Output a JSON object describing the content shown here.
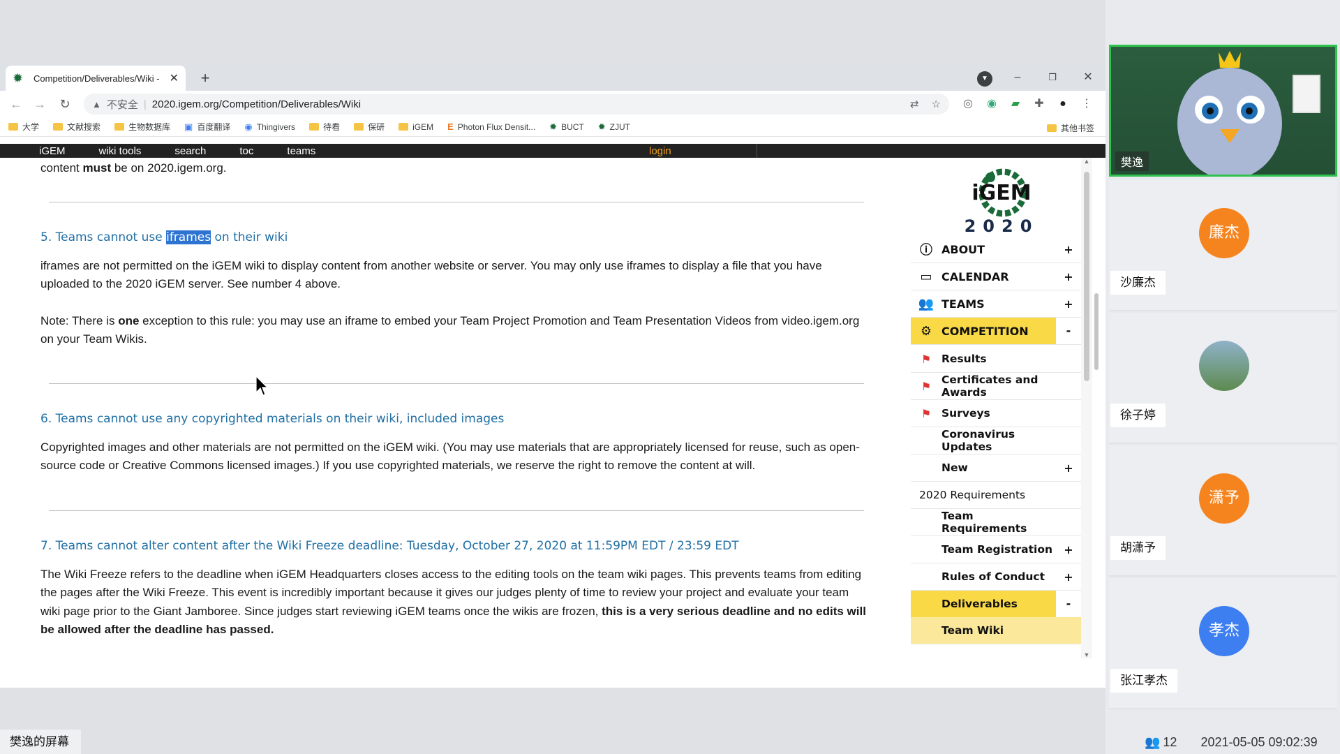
{
  "browser": {
    "tab_title": "Competition/Deliverables/Wiki -",
    "security_label": "不安全",
    "url": "2020.igem.org/Competition/Deliverables/Wiki",
    "bookmarks": [
      "大学",
      "文献搜索",
      "生物数据库",
      "百度翻译",
      "Thingivers",
      "待看",
      "保研",
      "iGEM",
      "Photon Flux Densit...",
      "BUCT",
      "ZJUT"
    ],
    "other_bookmarks": "其他书签"
  },
  "igem_nav": {
    "items": [
      "iGEM",
      "wiki tools",
      "search",
      "toc",
      "teams"
    ],
    "login": "login"
  },
  "article": {
    "top_partial_line": "content must be on 2020.igem.org.",
    "top_must": "must",
    "top_prefix": "content ",
    "top_suffix": " be on 2020.igem.org.",
    "h5_pre": "5. Teams cannot use ",
    "h5_highlight": "iframes",
    "h5_post": " on their wiki",
    "p5a": "iframes are not permitted on the iGEM wiki to display content from another website or server. You may only use iframes to display a file that you have uploaded to the 2020 iGEM server. See number 4 above.",
    "p5b_pre": "Note: There is ",
    "p5b_bold": "one",
    "p5b_post": " exception to this rule: you may use an iframe to embed your Team Project Promotion and Team Presentation Videos from video.igem.org on your Team Wikis.",
    "h6": "6. Teams cannot use any copyrighted materials on their wiki, included images",
    "p6": "Copyrighted images and other materials are not permitted on the iGEM wiki. (You may use materials that are appropriately licensed for reuse, such as open-source code or Creative Commons licensed images.) If you use copyrighted materials, we reserve the right to remove the content at will.",
    "h7": "7. Teams cannot alter content after the Wiki Freeze deadline: Tuesday, October 27, 2020 at 11:59PM EDT / 23:59 EDT",
    "p7_pre": "The Wiki Freeze refers to the deadline when iGEM Headquarters closes access to the editing tools on the team wiki pages. This prevents teams from editing the pages after the Wiki Freeze. This event is incredibly important because it gives our judges plenty of time to review your project and evaluate your team wiki page prior to the Giant Jamboree. Since judges start reviewing iGEM teams once the wikis are frozen, ",
    "p7_bold": "this is a very serious deadline and no edits will be allowed after the deadline has passed."
  },
  "sidebar": {
    "logo_text": "iGEM",
    "logo_year": "2020",
    "menu": [
      {
        "label": "ABOUT",
        "toggle": "+"
      },
      {
        "label": "CALENDAR",
        "toggle": "+"
      },
      {
        "label": "TEAMS",
        "toggle": "+"
      },
      {
        "label": "COMPETITION",
        "toggle": "-"
      },
      {
        "label": "Results",
        "toggle": ""
      },
      {
        "label": "Certificates and Awards",
        "toggle": ""
      },
      {
        "label": "Surveys",
        "toggle": ""
      },
      {
        "label": "Coronavirus Updates",
        "toggle": ""
      },
      {
        "label": "New",
        "toggle": "+"
      },
      {
        "label": "2020 Requirements",
        "toggle": ""
      },
      {
        "label": "Team Requirements",
        "toggle": ""
      },
      {
        "label": "Team Registration",
        "toggle": "+"
      },
      {
        "label": "Rules of Conduct",
        "toggle": "+"
      },
      {
        "label": "Deliverables",
        "toggle": "-"
      },
      {
        "label": "Team Wiki",
        "toggle": ""
      }
    ]
  },
  "share_label": "樊逸的屏幕",
  "meeting": {
    "self_name": "樊逸",
    "participants": [
      {
        "avatar": "廉杰",
        "name": "沙廉杰",
        "color": "#f5841f"
      },
      {
        "avatar": "",
        "name": "徐子婷",
        "color": "#6b8f6b"
      },
      {
        "avatar": "潇予",
        "name": "胡潇予",
        "color": "#f5841f"
      },
      {
        "avatar": "孝杰",
        "name": "张江孝杰",
        "color": "#3d7ef0"
      }
    ],
    "participant_count": "12",
    "timestamp": "2021-05-05 09:02:39"
  },
  "colors": {
    "active_yellow": "#f9d946",
    "heading_blue": "#1f6fa4",
    "speaker_border": "#2fc24e"
  }
}
